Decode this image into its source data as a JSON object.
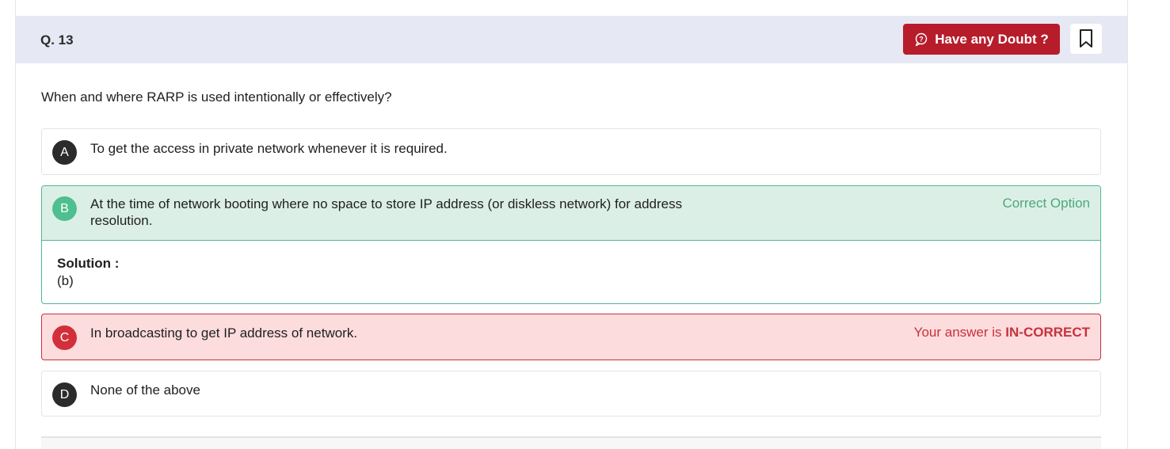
{
  "question": {
    "number": "Q. 13",
    "text": "When and where RARP is used intentionally or effectively?",
    "doubt_label": "Have any Doubt ?"
  },
  "options": [
    {
      "letter": "A",
      "text": "To get the access in private network whenever it is required."
    },
    {
      "letter": "B",
      "text": "At the time of network booting where no space to store IP address (or diskless network) for address resolution.",
      "status": "Correct Option"
    },
    {
      "letter": "C",
      "text": "In broadcasting to get IP address of network.",
      "status_prefix": "Your answer is ",
      "status_emph": "IN-CORRECT"
    },
    {
      "letter": "D",
      "text": "None of the above"
    }
  ],
  "solution": {
    "title": "Solution :",
    "text": "(b)"
  },
  "colors": {
    "doubt_button": "#b71c2b",
    "correct": "#4fbf90",
    "incorrect": "#c6323d",
    "header_bg": "#e6e9f3"
  }
}
